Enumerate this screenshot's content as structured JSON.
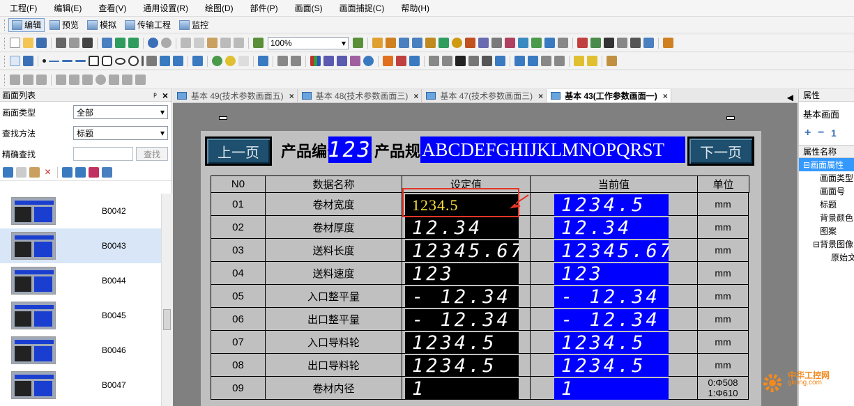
{
  "menu": [
    "工程(F)",
    "编辑(E)",
    "查看(V)",
    "通用设置(R)",
    "绘图(D)",
    "部件(P)",
    "画面(S)",
    "画面捕捉(C)",
    "帮助(H)"
  ],
  "modes": [
    {
      "label": "编辑",
      "active": true
    },
    {
      "label": "预览",
      "active": false
    },
    {
      "label": "模拟",
      "active": false
    },
    {
      "label": "传输工程",
      "active": false
    },
    {
      "label": "监控",
      "active": false
    }
  ],
  "zoom": "100%",
  "left_panel": {
    "title": "画面列表",
    "pin": "ᵖ",
    "close": "×",
    "type_label": "画面类型",
    "type_value": "全部",
    "find_label": "查找方法",
    "find_value": "标题",
    "exact_label": "精确查找",
    "find_button": "查找",
    "items": [
      {
        "code": "B0042",
        "selected": false
      },
      {
        "code": "B0043",
        "selected": true
      },
      {
        "code": "B0044",
        "selected": false
      },
      {
        "code": "B0045",
        "selected": false
      },
      {
        "code": "B0046",
        "selected": false
      },
      {
        "code": "B0047",
        "selected": false
      }
    ]
  },
  "tabs": [
    {
      "label": "基本 49(技术参数画面五)",
      "active": false
    },
    {
      "label": "基本 48(技术参数画面三)",
      "active": false
    },
    {
      "label": "基本 47(技术参数画面三)",
      "active": false
    },
    {
      "label": "基本 43(工作参数画面一)",
      "active": true
    }
  ],
  "screen": {
    "prev_button": "上一页",
    "next_button": "下一页",
    "product_no_label": "产品编号",
    "product_no_value": "123",
    "product_spec_label": "产品规格",
    "product_spec_value": "ABCDEFGHIJKLMNOPQRST",
    "headers": [
      "N0",
      "数据名称",
      "设定值",
      "当前值",
      "单位"
    ],
    "rows": [
      {
        "no": "01",
        "name": "卷材宽度",
        "set": "1234.5",
        "cur": "1234.5",
        "unit": "mm"
      },
      {
        "no": "02",
        "name": "卷材厚度",
        "set": "12.34",
        "cur": "12.34",
        "unit": "mm"
      },
      {
        "no": "03",
        "name": "送料长度",
        "set": "12345.67",
        "cur": "12345.67",
        "unit": "mm"
      },
      {
        "no": "04",
        "name": "送料速度",
        "set": "123",
        "cur": "123",
        "unit": "mm"
      },
      {
        "no": "05",
        "name": "入口整平量",
        "set": "- 12.34",
        "cur": "- 12.34",
        "unit": "mm"
      },
      {
        "no": "06",
        "name": "出口整平量",
        "set": "- 12.34",
        "cur": "- 12.34",
        "unit": "mm"
      },
      {
        "no": "07",
        "name": "入口导料轮",
        "set": "1234.5",
        "cur": "1234.5",
        "unit": "mm"
      },
      {
        "no": "08",
        "name": "出口导料轮",
        "set": "1234.5",
        "cur": "1234.5",
        "unit": "mm"
      },
      {
        "no": "09",
        "name": "卷材内径",
        "set": "1",
        "cur": "1",
        "unit": "0:Φ508\n1:Φ610"
      }
    ]
  },
  "right_panel": {
    "title": "属性",
    "screen_type": "基本画面",
    "col_header": "属性名称",
    "props": [
      "画面属性",
      "画面类型",
      "画面号",
      "标题",
      "背景颜色",
      "图案",
      "背景图像",
      "原始文"
    ]
  },
  "watermark": {
    "brand": "中华工控网",
    "url": "gkong.com"
  },
  "colors": {
    "selected_row": "#d9e6f8",
    "blue_display": "#0000ff",
    "screen_bg": "#c0c0c0",
    "canvas_bg": "#808080",
    "highlight": "#e53525"
  }
}
